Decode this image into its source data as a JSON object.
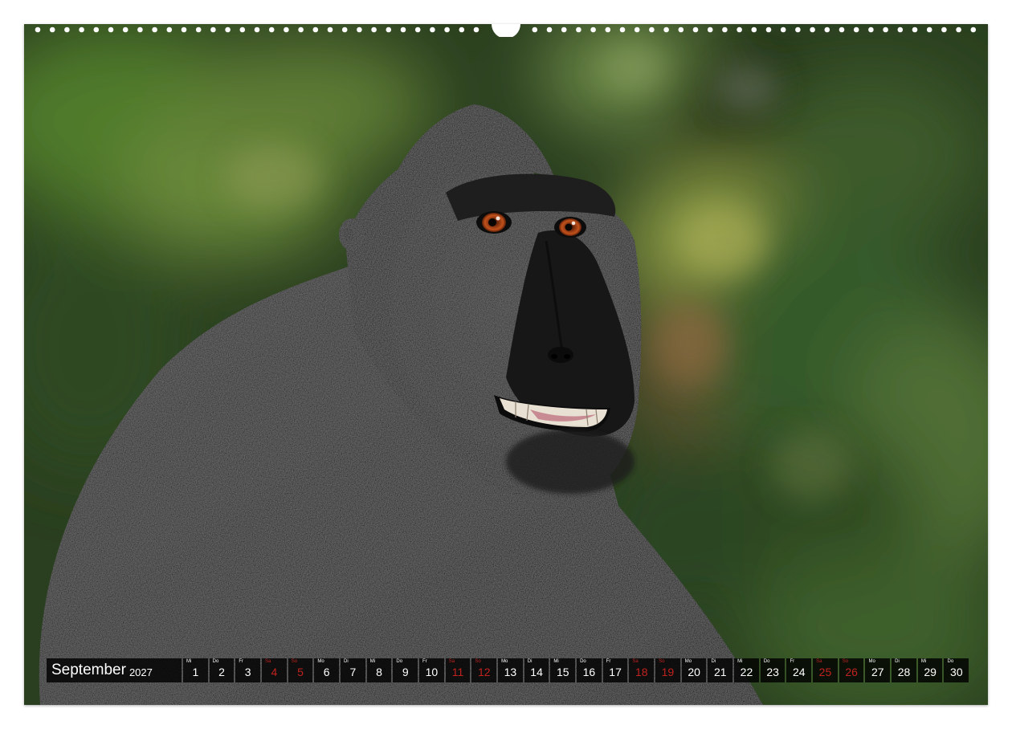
{
  "calendar": {
    "month": "September",
    "year": "2027",
    "holiday_color": "#c0221e",
    "days": [
      {
        "wd": "Mi",
        "num": "1",
        "red": false
      },
      {
        "wd": "Do",
        "num": "2",
        "red": false
      },
      {
        "wd": "Fr",
        "num": "3",
        "red": false
      },
      {
        "wd": "Sa",
        "num": "4",
        "red": true
      },
      {
        "wd": "So",
        "num": "5",
        "red": true
      },
      {
        "wd": "Mo",
        "num": "6",
        "red": false
      },
      {
        "wd": "Di",
        "num": "7",
        "red": false
      },
      {
        "wd": "Mi",
        "num": "8",
        "red": false
      },
      {
        "wd": "Do",
        "num": "9",
        "red": false
      },
      {
        "wd": "Fr",
        "num": "10",
        "red": false
      },
      {
        "wd": "Sa",
        "num": "11",
        "red": true
      },
      {
        "wd": "So",
        "num": "12",
        "red": true
      },
      {
        "wd": "Mo",
        "num": "13",
        "red": false
      },
      {
        "wd": "Di",
        "num": "14",
        "red": false
      },
      {
        "wd": "Mi",
        "num": "15",
        "red": false
      },
      {
        "wd": "Do",
        "num": "16",
        "red": false
      },
      {
        "wd": "Fr",
        "num": "17",
        "red": false
      },
      {
        "wd": "Sa",
        "num": "18",
        "red": true
      },
      {
        "wd": "So",
        "num": "19",
        "red": true
      },
      {
        "wd": "Mo",
        "num": "20",
        "red": false
      },
      {
        "wd": "Di",
        "num": "21",
        "red": false
      },
      {
        "wd": "Mi",
        "num": "22",
        "red": false
      },
      {
        "wd": "Do",
        "num": "23",
        "red": false
      },
      {
        "wd": "Fr",
        "num": "24",
        "red": false
      },
      {
        "wd": "Sa",
        "num": "25",
        "red": true
      },
      {
        "wd": "So",
        "num": "26",
        "red": true
      },
      {
        "wd": "Mo",
        "num": "27",
        "red": false
      },
      {
        "wd": "Di",
        "num": "28",
        "red": false
      },
      {
        "wd": "Mi",
        "num": "29",
        "red": false
      },
      {
        "wd": "Do",
        "num": "30",
        "red": false
      }
    ]
  }
}
